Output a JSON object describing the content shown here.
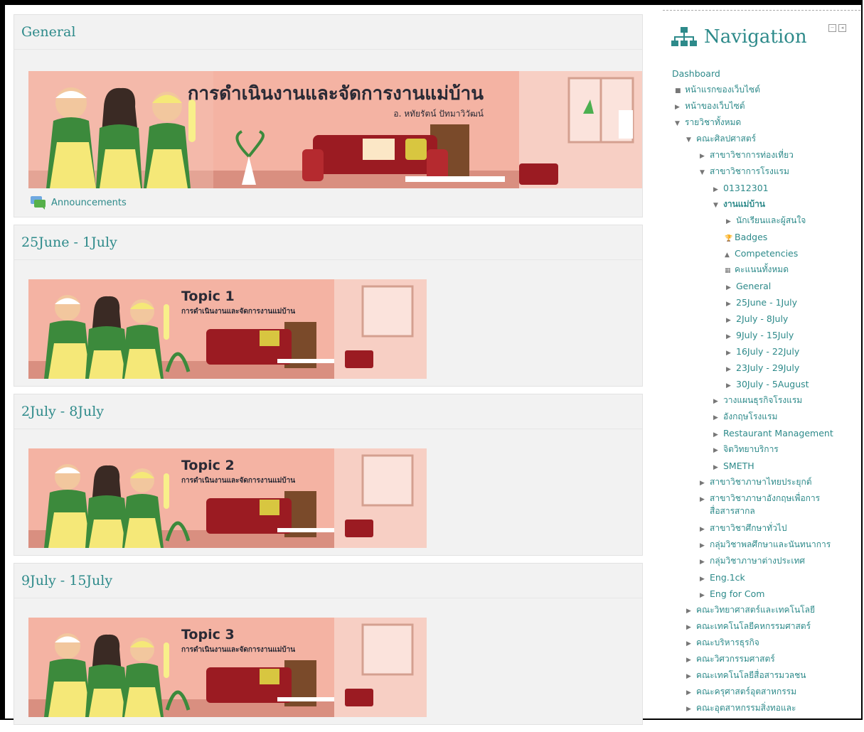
{
  "sections": [
    {
      "title": "General",
      "banner_heading": "การดำเนินงานและจัดการงานแม่บ้าน",
      "banner_author": "อ. หทัยรัตน์ ปัทมาวิวัฒน์",
      "link": "Announcements"
    },
    {
      "title": "25June - 1July",
      "topic": "Topic 1",
      "topic_sub": "การดำเนินงานและจัดการงานแม่บ้าน"
    },
    {
      "title": "2July - 8July",
      "topic": "Topic 2",
      "topic_sub": "การดำเนินงานและจัดการงานแม่บ้าน"
    },
    {
      "title": "9July - 15July",
      "topic": "Topic 3",
      "topic_sub": "การดำเนินงานและจัดการงานแม่บ้าน"
    }
  ],
  "navigation": {
    "title": "Navigation",
    "items": [
      {
        "label": "Dashboard",
        "marker": ""
      },
      {
        "label": "หน้าแรกของเว็บไซต์",
        "marker": "■"
      },
      {
        "label": "หน้าของเว็บไซต์",
        "marker": "▶"
      },
      {
        "label": "รายวิชาทั้งหมด",
        "marker": "▼"
      },
      {
        "label": "คณะศิลปศาสตร์",
        "marker": "▼"
      },
      {
        "label": "สาขาวิชาการท่องเที่ยว",
        "marker": "▶"
      },
      {
        "label": "สาขาวิชาการโรงแรม",
        "marker": "▼"
      },
      {
        "label": "01312301",
        "marker": "▶"
      },
      {
        "label": "งานแม่บ้าน",
        "marker": "▼"
      },
      {
        "label": "นักเรียนและผู้สนใจ",
        "marker": "▶"
      },
      {
        "label": "Badges",
        "marker": "🏆"
      },
      {
        "label": "Competencies",
        "marker": "▲"
      },
      {
        "label": "คะแนนทั้งหมด",
        "marker": "▦"
      },
      {
        "label": "General",
        "marker": "▶"
      },
      {
        "label": "25June - 1July",
        "marker": "▶"
      },
      {
        "label": "2July - 8July",
        "marker": "▶"
      },
      {
        "label": "9July - 15July",
        "marker": "▶"
      },
      {
        "label": "16July - 22July",
        "marker": "▶"
      },
      {
        "label": "23July - 29July",
        "marker": "▶"
      },
      {
        "label": "30July - 5August",
        "marker": "▶"
      },
      {
        "label": "วางแผนธุรกิจโรงแรม",
        "marker": "▶"
      },
      {
        "label": "อังกฤษโรงแรม",
        "marker": "▶"
      },
      {
        "label": "Restaurant Management",
        "marker": "▶"
      },
      {
        "label": "จิตวิทยาบริการ",
        "marker": "▶"
      },
      {
        "label": "SMETH",
        "marker": "▶"
      },
      {
        "label": "สาขาวิชาภาษาไทยประยุกต์",
        "marker": "▶"
      },
      {
        "label": "สาขาวิชาภาษาอังกฤษเพื่อการ",
        "marker": "▶"
      },
      {
        "label": "สื่อสารสากล",
        "marker": ""
      },
      {
        "label": "สาขาวิชาศึกษาทั่วไป",
        "marker": "▶"
      },
      {
        "label": "กลุ่มวิชาพลศึกษาและนันทนาการ",
        "marker": "▶"
      },
      {
        "label": "กลุ่มวิชาภาษาต่างประเทศ",
        "marker": "▶"
      },
      {
        "label": "Eng.1ck",
        "marker": "▶"
      },
      {
        "label": "Eng for Com",
        "marker": "▶"
      },
      {
        "label": "คณะวิทยาศาสตร์และเทคโนโลยี",
        "marker": "▶"
      },
      {
        "label": "คณะเทคโนโลยีคหกรรมศาสตร์",
        "marker": "▶"
      },
      {
        "label": "คณะบริหารธุรกิจ",
        "marker": "▶"
      },
      {
        "label": "คณะวิศวกรรมศาสตร์",
        "marker": "▶"
      },
      {
        "label": "คณะเทคโนโลยีสื่อสารมวลชน",
        "marker": "▶"
      },
      {
        "label": "คณะครุศาสตร์อุตสาหกรรม",
        "marker": "▶"
      },
      {
        "label": "คณะอุตสาหกรรมสิ่งทอและ",
        "marker": "▶"
      }
    ]
  },
  "colors": {
    "accent": "#2d8a8a",
    "banner_bg": "#f4b3a3",
    "sofa": "#9b1b22",
    "dress": "#f5e878",
    "shirt": "#3c8a3c"
  }
}
